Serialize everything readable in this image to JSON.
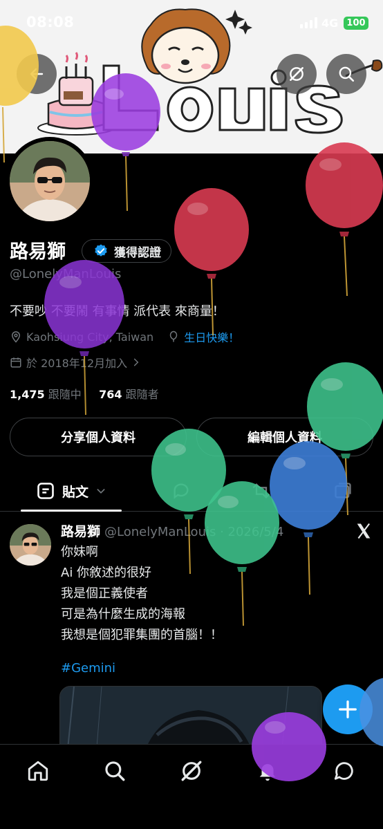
{
  "status_bar": {
    "time": "08:08",
    "network": "4G",
    "battery": "100"
  },
  "banner": {
    "word": "Louis"
  },
  "profile": {
    "name": "路易獅",
    "verified_label": "獲得認證",
    "handle": "@LonelyManLouis",
    "bio": "不要吵 不要鬧 有事情 派代表 來商量！",
    "location": "Kaohsiung City, Taiwan",
    "birthday": "生日快樂！",
    "joined": "於 2018年12月加入",
    "following_count": "1,475",
    "following_label": "跟隨中",
    "followers_count": "764",
    "followers_label": "跟隨者"
  },
  "actions": {
    "share": "分享個人資料",
    "edit": "編輯個人資料"
  },
  "tabs": {
    "posts": "貼文"
  },
  "tweet": {
    "author": "路易獅",
    "handle_date": "@LonelyManLouis · 2026/5/4",
    "lines": [
      "你妹啊",
      "Ai 你敘述的很好",
      "我是個正義使者",
      "可是為什麼生成的海報",
      "我想是個犯罪集團的首腦！！"
    ],
    "hashtag": "#Gemini"
  },
  "colors": {
    "accent": "#1d9bf0",
    "verified": "#1d9bf0",
    "background": "#000000",
    "muted": "#71767b"
  },
  "icons": {
    "header": [
      "back-arrow-icon",
      "grok-icon",
      "search-icon"
    ],
    "nav": [
      "home-icon",
      "search-icon",
      "grok-icon",
      "bell-icon",
      "message-icon"
    ],
    "tabs": [
      "reply-icon",
      "retweet-icon",
      "media-icon"
    ]
  }
}
